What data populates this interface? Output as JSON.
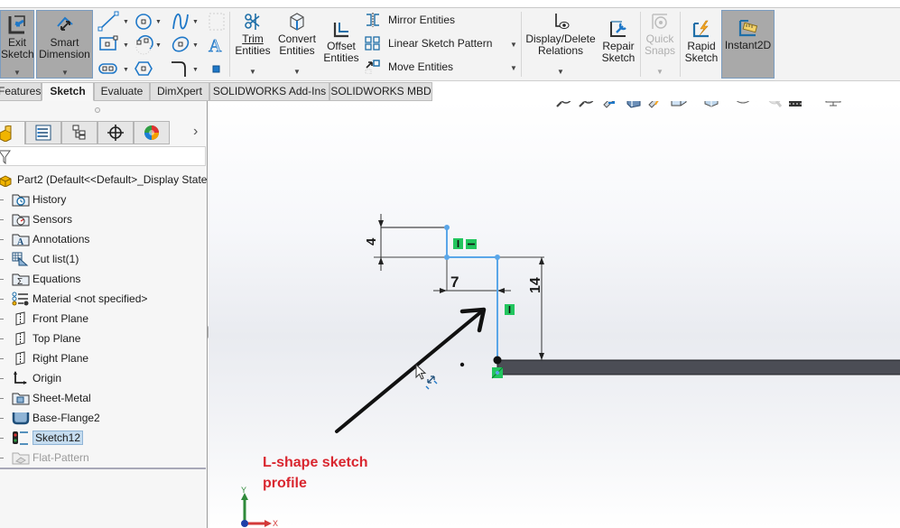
{
  "ribbon": {
    "exit_sketch": {
      "line1": "Exit",
      "line2": "Sketch"
    },
    "smart_dimension": {
      "line1": "Smart",
      "line2": "Dimension"
    },
    "trim_entities": {
      "line1": "Trim",
      "line2": "Entities"
    },
    "convert_entities": {
      "line1": "Convert",
      "line2": "Entities"
    },
    "offset_entities": {
      "line1": "Offset",
      "line2": "Entities"
    },
    "mirror_entities": "Mirror Entities",
    "linear_sketch_pattern": "Linear Sketch Pattern",
    "move_entities": "Move Entities",
    "display_delete_relations": {
      "line1": "Display/Delete",
      "line2": "Relations"
    },
    "repair_sketch": {
      "line1": "Repair",
      "line2": "Sketch"
    },
    "quick_snaps": {
      "line1": "Quick",
      "line2": "Snaps"
    },
    "rapid_sketch": {
      "line1": "Rapid",
      "line2": "Sketch"
    },
    "instant2d": "Instant2D",
    "sketch_tools": [
      "line",
      "circle",
      "spline",
      "rectangle",
      "arc",
      "ellipse",
      "slot",
      "polygon",
      "fillet",
      "plane",
      "text",
      "point"
    ]
  },
  "tabs": [
    {
      "label": "Features",
      "active": false
    },
    {
      "label": "Sketch",
      "active": true
    },
    {
      "label": "Evaluate",
      "active": false
    },
    {
      "label": "DimXpert",
      "active": false
    },
    {
      "label": "SOLIDWORKS Add-Ins",
      "active": false
    },
    {
      "label": "SOLIDWORKS MBD",
      "active": false
    }
  ],
  "panel_tabs": [
    "feature-manager",
    "property-manager",
    "configuration-manager",
    "dimxpert-manager",
    "display-manager"
  ],
  "tree": {
    "root": "Part2  (Default<<Default>_Display State",
    "items": [
      {
        "label": "History",
        "icon": "history-folder"
      },
      {
        "label": "Sensors",
        "icon": "sensors-folder"
      },
      {
        "label": "Annotations",
        "icon": "annotations-folder"
      },
      {
        "label": "Cut list(1)",
        "icon": "cut-list"
      },
      {
        "label": "Equations",
        "icon": "equations-folder"
      },
      {
        "label": "Material <not specified>",
        "icon": "material"
      },
      {
        "label": "Front Plane",
        "icon": "plane"
      },
      {
        "label": "Top Plane",
        "icon": "plane"
      },
      {
        "label": "Right Plane",
        "icon": "plane"
      },
      {
        "label": "Origin",
        "icon": "origin"
      },
      {
        "label": "Sheet-Metal",
        "icon": "sheet-metal-folder"
      },
      {
        "label": "Base-Flange2",
        "icon": "base-flange"
      },
      {
        "label": "Sketch12",
        "icon": "sketch",
        "selected": true
      },
      {
        "label": "Flat-Pattern",
        "icon": "flat-pattern",
        "dimmed": true
      }
    ]
  },
  "sketch": {
    "dimensions": {
      "top_height": "4",
      "horizontal": "7",
      "vertical": "14"
    },
    "relations": [
      "vertical",
      "horizontal",
      "vertical"
    ]
  },
  "annotation": {
    "line1": "L-shape sketch",
    "line2": "profile"
  },
  "axes": {
    "x": "X",
    "y": "Y"
  },
  "colors": {
    "sketch_line": "#5aa6e8",
    "relation_badge": "#22c55e",
    "annotation": "#d9262f",
    "flange": "#4b4d55"
  }
}
